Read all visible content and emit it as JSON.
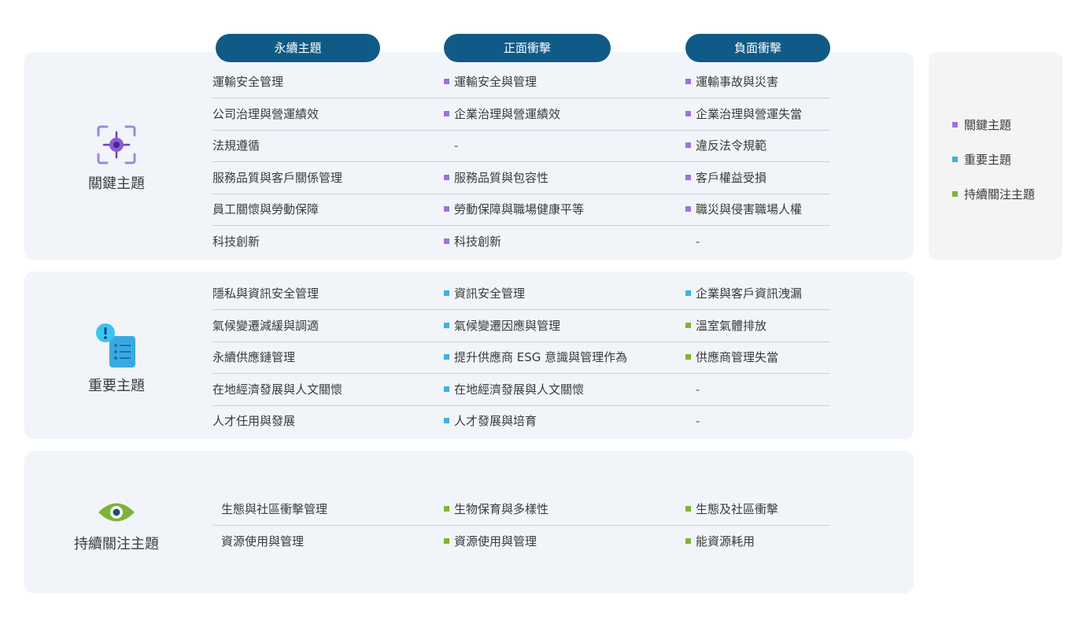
{
  "headers": [
    "永續主題",
    "正面衝擊",
    "負面衝擊"
  ],
  "colors": {
    "key": "#a172d8",
    "important": "#3cb1e4",
    "watch": "#7db438",
    "header": "#0f5a86"
  },
  "legend": [
    {
      "label": "關鍵主題",
      "color": "#a172d8"
    },
    {
      "label": "重要主題",
      "color": "#3cb1e4"
    },
    {
      "label": "持續關注主題",
      "color": "#7db438"
    }
  ],
  "groups": [
    {
      "name": "關鍵主題",
      "icon": "target-icon",
      "rows": [
        {
          "topic": "運輸安全管理",
          "positive": "運輸安全與管理",
          "positive_color": "#a172d8",
          "negative": "運輸事故與災害",
          "negative_color": "#a172d8"
        },
        {
          "topic": "公司治理與營運績效",
          "positive": "企業治理與營運績效",
          "positive_color": "#a172d8",
          "negative": "企業治理與營運失當",
          "negative_color": "#a172d8"
        },
        {
          "topic": "法規遵循",
          "positive": "-",
          "positive_color": "",
          "negative": "違反法令規範",
          "negative_color": "#a172d8"
        },
        {
          "topic": "服務品質與客戶關係管理",
          "positive": "服務品質與包容性",
          "positive_color": "#a172d8",
          "negative": "客戶權益受損",
          "negative_color": "#a172d8"
        },
        {
          "topic": "員工關懷與勞動保障",
          "positive": "勞動保障與職場健康平等",
          "positive_color": "#a172d8",
          "negative": "職災與侵害職場人權",
          "negative_color": "#a172d8"
        },
        {
          "topic": "科技創新",
          "positive": "科技創新",
          "positive_color": "#a172d8",
          "negative": "-",
          "negative_color": ""
        }
      ]
    },
    {
      "name": "重要主題",
      "icon": "alert-document-icon",
      "rows": [
        {
          "topic": "隱私與資訊安全管理",
          "positive": "資訊安全管理",
          "positive_color": "#3cb1e4",
          "negative": "企業與客戶資訊洩漏",
          "negative_color": "#3cb1e4"
        },
        {
          "topic": "氣候變遷減緩與調適",
          "positive": "氣候變遷因應與管理",
          "positive_color": "#3cb1e4",
          "negative": "溫室氣體排放",
          "negative_color": "#7db438"
        },
        {
          "topic": "永續供應鏈管理",
          "positive": "提升供應商 ESG 意識與管理作為",
          "positive_color": "#3cb1e4",
          "negative": "供應商管理失當",
          "negative_color": "#7db438"
        },
        {
          "topic": "在地經濟發展與人文關懷",
          "positive": "在地經濟發展與人文關懷",
          "positive_color": "#3cb1e4",
          "negative": "-",
          "negative_color": ""
        },
        {
          "topic": "人才任用與發展",
          "positive": "人才發展與培育",
          "positive_color": "#3cb1e4",
          "negative": "-",
          "negative_color": ""
        }
      ]
    },
    {
      "name": "持續關注主題",
      "icon": "eye-icon",
      "rows": [
        {
          "topic": "生態與社區衝擊管理",
          "positive": "生物保育與多樣性",
          "positive_color": "#7db438",
          "negative": "生態及社區衝擊",
          "negative_color": "#7db438"
        },
        {
          "topic": "資源使用與管理",
          "positive": "資源使用與管理",
          "positive_color": "#7db438",
          "negative": "能資源耗用",
          "negative_color": "#7db438"
        }
      ]
    }
  ]
}
